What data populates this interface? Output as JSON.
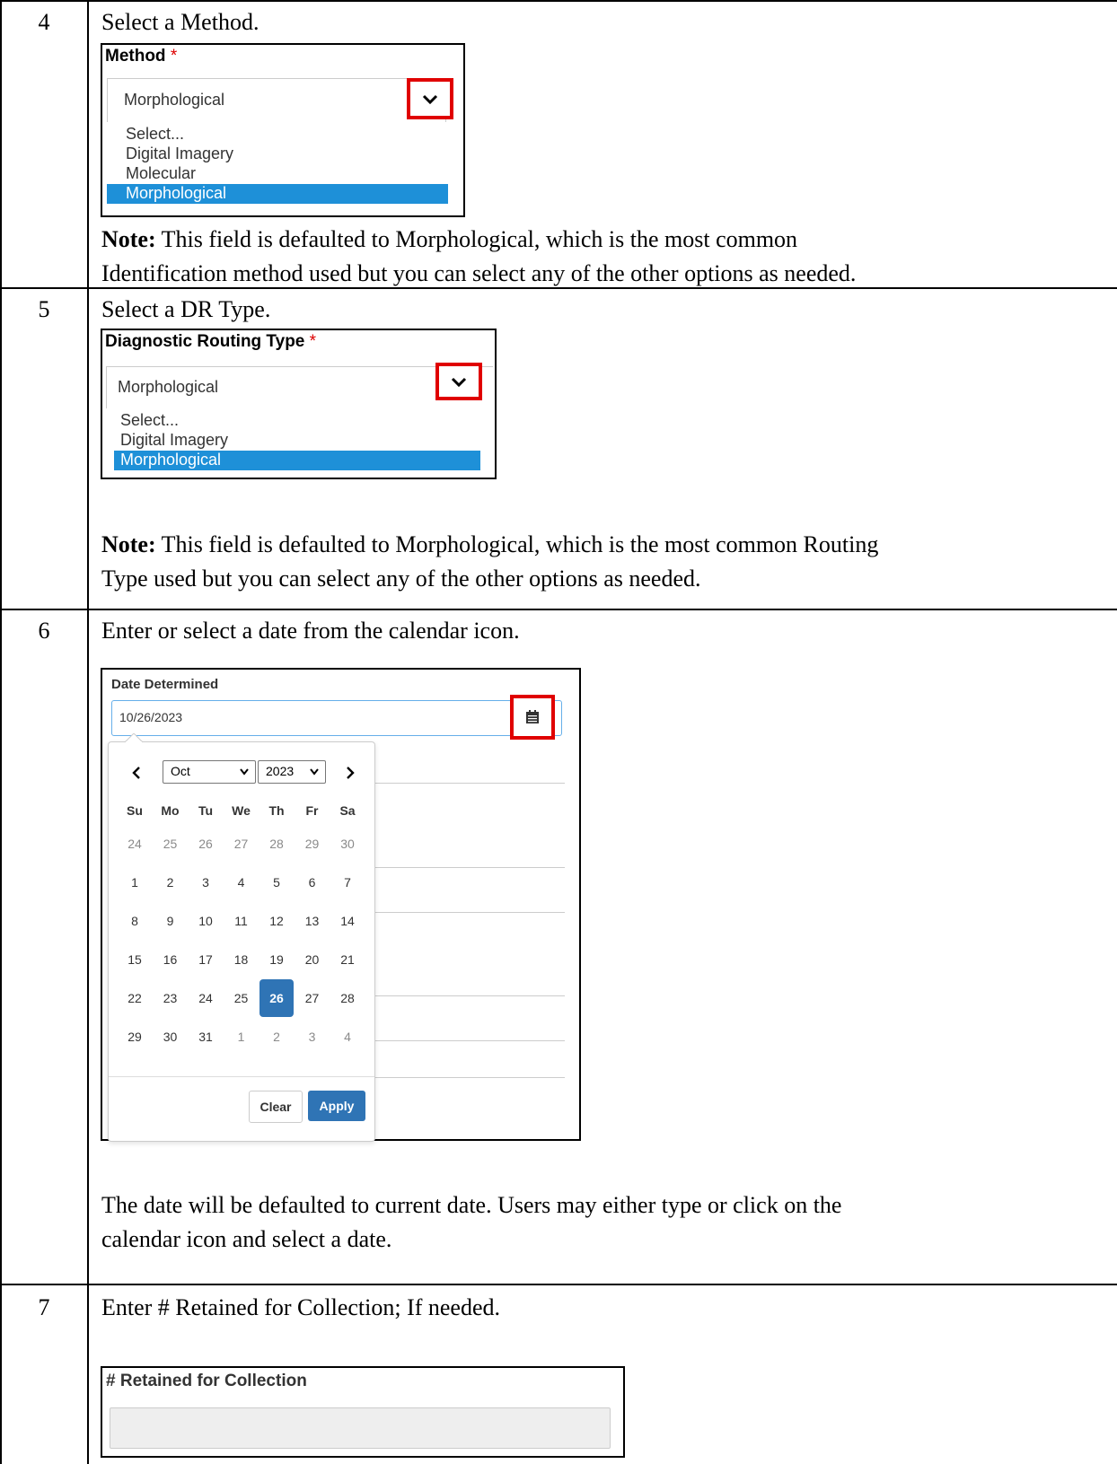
{
  "steps": [
    {
      "number": "4",
      "instruction": "Select a Method.",
      "field_label": "Method",
      "required_mark": "*",
      "selected_value": "Morphological",
      "options": [
        "Select...",
        "Digital Imagery",
        "Molecular",
        "Morphological"
      ],
      "note_bold": "Note:",
      "note_text_1": "This field is defaulted to Morphological, which is the most common",
      "note_text_2": "Identification method used but you can select any of the other options as needed."
    },
    {
      "number": "5",
      "instruction": "Select a DR Type.",
      "field_label": "Diagnostic Routing Type",
      "required_mark": "*",
      "selected_value": "Morphological",
      "options": [
        "Select...",
        "Digital Imagery",
        "Morphological"
      ],
      "note_bold": "Note:",
      "note_text_1": "This field is defaulted to Morphological, which is the most common Routing",
      "note_text_2": "Type used but you can select any of the other options as needed."
    },
    {
      "number": "6",
      "instruction": "Enter or select a date from the calendar icon.",
      "field_label": "Date Determined",
      "date_value": "10/26/2023",
      "calendar": {
        "month": "Oct",
        "year": "2023",
        "weekdays": [
          "Su",
          "Mo",
          "Tu",
          "We",
          "Th",
          "Fr",
          "Sa"
        ],
        "weeks": [
          [
            "24",
            "25",
            "26",
            "27",
            "28",
            "29",
            "30"
          ],
          [
            "1",
            "2",
            "3",
            "4",
            "5",
            "6",
            "7"
          ],
          [
            "8",
            "9",
            "10",
            "11",
            "12",
            "13",
            "14"
          ],
          [
            "15",
            "16",
            "17",
            "18",
            "19",
            "20",
            "21"
          ],
          [
            "22",
            "23",
            "24",
            "25",
            "26",
            "27",
            "28"
          ],
          [
            "29",
            "30",
            "31",
            "1",
            "2",
            "3",
            "4"
          ]
        ],
        "selected_day": "26",
        "clear_label": "Clear",
        "apply_label": "Apply"
      },
      "note_text_1": "The date will be defaulted to current date. Users may either type or click on the",
      "note_text_2": "calendar icon and select a date."
    },
    {
      "number": "7",
      "instruction": "Enter # Retained for Collection; If needed.",
      "field_label": "# Retained for Collection",
      "input_value": ""
    }
  ],
  "colors": {
    "highlight_box": "#e00000",
    "selected_option": "#1e90d8",
    "calendar_selected": "#2f74b5",
    "apply_button": "#2f74b5"
  }
}
